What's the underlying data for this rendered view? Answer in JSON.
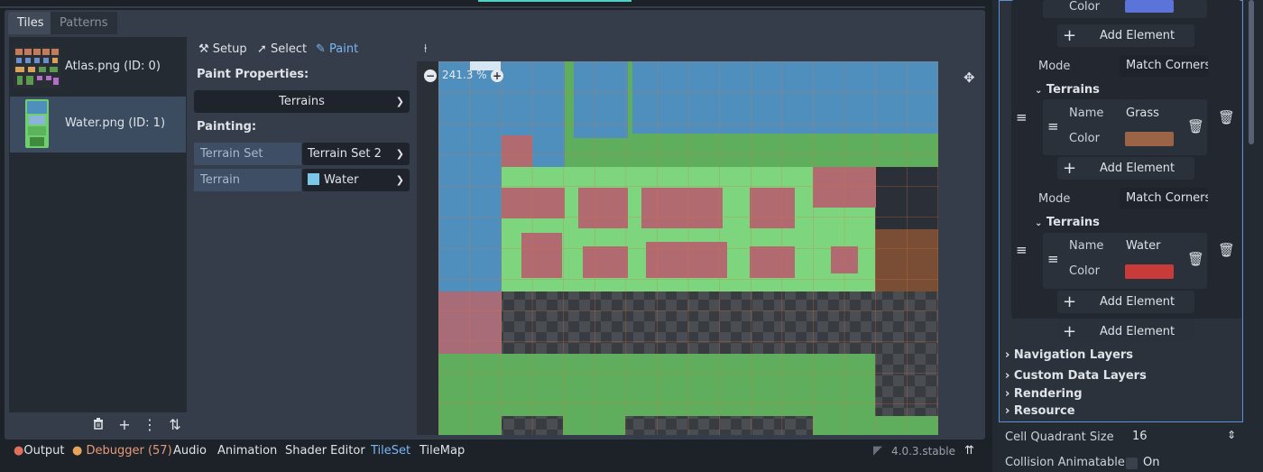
{
  "tabs": {
    "tiles": "Tiles",
    "patterns": "Patterns"
  },
  "sources": [
    {
      "label": "Atlas.png (ID: 0)"
    },
    {
      "label": "Water.png (ID: 1)"
    }
  ],
  "toolbar": {
    "setup": "Setup",
    "select": "Select",
    "paint": "Paint"
  },
  "paint": {
    "properties_heading": "Paint Properties:",
    "mode_value": "Terrains",
    "painting_heading": "Painting:",
    "terrain_set_label": "Terrain Set",
    "terrain_set_value": "Terrain Set 2",
    "terrain_label": "Terrain",
    "terrain_value": "Water"
  },
  "canvas": {
    "zoom": "241.3 %"
  },
  "bottom_tabs": {
    "output": "Output",
    "debugger": "Debugger (57)",
    "audio": "Audio",
    "animation": "Animation",
    "shader": "Shader Editor",
    "tileset": "TileSet",
    "tilemap": "TileMap"
  },
  "version": "4.0.3.stable",
  "inspector": {
    "color_label": "Color",
    "add_element": "Add Element",
    "mode_label": "Mode",
    "mode_value": "Match Corners",
    "terrains_label": "Terrains",
    "name_label": "Name",
    "grass_name": "Grass",
    "water_name": "Water",
    "nav_layers": "Navigation Layers",
    "custom_data": "Custom Data Layers",
    "rendering": "Rendering",
    "resource": "Resource",
    "quadrant_label": "Cell Quadrant Size",
    "quadrant_value": "16",
    "collision_label": "Collision Animatable",
    "collision_value": "On"
  },
  "colors": {
    "accent": "#7ab6f5",
    "blue_swatch": "#5a74d9",
    "brown_swatch": "#9b6446",
    "red_swatch": "#c93a3a",
    "water_fill": "#4e8fbd",
    "grass_fill": "#7dd67d",
    "dirt_fill": "#b06a70",
    "pink_fill": "#a86b78"
  }
}
